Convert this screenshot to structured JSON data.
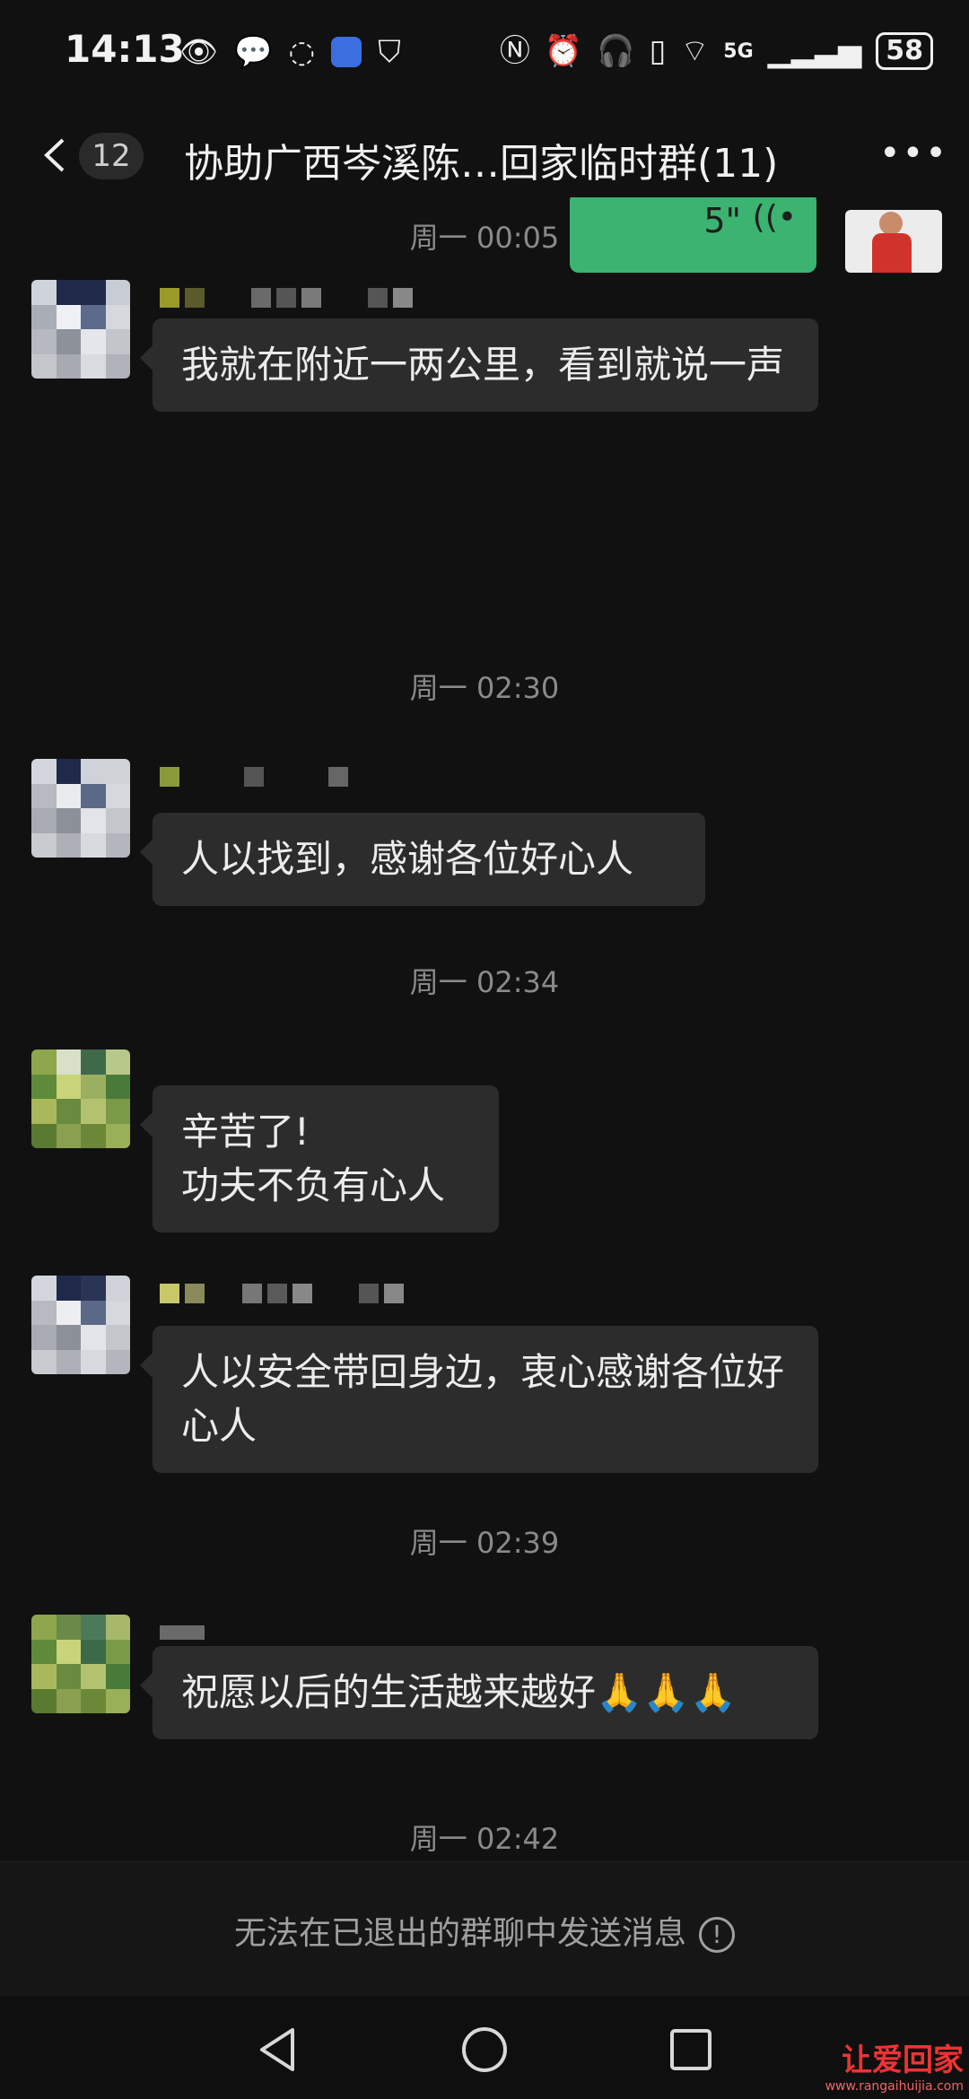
{
  "status_bar": {
    "time": "14:13",
    "signal_label": "5G",
    "battery": "58"
  },
  "header": {
    "unread_count": "12",
    "title": "协助广西岑溪陈…回家临时群(11)"
  },
  "messages": {
    "sent_voice_duration": "5\"",
    "t1": "周一 00:05",
    "m1": "我就在附近一两公里，看到就说一声",
    "t2": "周一 02:30",
    "m2": "人以找到，感谢各位好心人",
    "t3": "周一 02:34",
    "m3_line1": "辛苦了!",
    "m3_line2": "功夫不负有心人",
    "m4": "人以安全带回身边，衷心感谢各位好心人",
    "t4": "周一 02:39",
    "m5": "祝愿以后的生活越来越好🙏🙏🙏",
    "t5": "周一 02:42"
  },
  "footer": {
    "notice": "无法在已退出的群聊中发送消息"
  },
  "watermark": {
    "brand": "让爱回家",
    "url": "www.rangaihuijia.com"
  },
  "colors": {
    "background": "#111111",
    "bubble": "#2c2c2c",
    "sent_bubble": "#3cb371",
    "time_text": "#8a8a8a"
  }
}
